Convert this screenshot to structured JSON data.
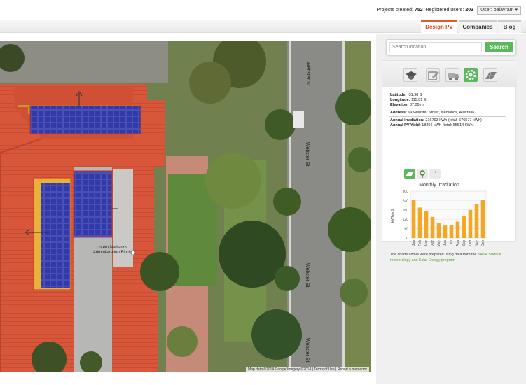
{
  "header": {
    "projects_label": "Projects created:",
    "projects_count": "752",
    "users_label": "Registered users:",
    "users_count": "203",
    "user_select": "User: balavram"
  },
  "nav": {
    "tabs": [
      {
        "label": "Design PV",
        "active": true
      },
      {
        "label": "Companies",
        "active": false
      },
      {
        "label": "Blog",
        "active": false
      }
    ]
  },
  "map": {
    "street_labels": [
      "Webster St",
      "Webster St",
      "Webster St",
      "Webster St"
    ],
    "building_label": "Loreto Nedlands Administration Block",
    "attribution": "Map data ©2014 Google Imagery ©2014 | Terms of Use | Report a map error"
  },
  "search": {
    "placeholder": "Search location...",
    "button": "Search"
  },
  "tools": [
    {
      "icon": "graduation-cap-icon"
    },
    {
      "icon": "edit-icon"
    },
    {
      "icon": "truck-icon"
    },
    {
      "icon": "gear-icon"
    },
    {
      "icon": "solar-panel-icon"
    }
  ],
  "location": {
    "latitude_label": "Latitude:",
    "latitude": "-31.98 S",
    "longitude_label": "Longitude:",
    "longitude": "115.81 E",
    "elevation_label": "Elevation:",
    "elevation": "37.06 m",
    "address_label": "Address:",
    "address": "69 Webster Street, Nedlands, Australia",
    "irradiation_label": "Annual irradiation:",
    "irradiation": "216793 kWh (total: 576577 kWh)",
    "yield_label": "Annual PV Yield:",
    "yield": "18256 kWh (total: 55514 kWh)"
  },
  "chart_tabs": [
    {
      "icon": "panel-chart-icon"
    },
    {
      "icon": "map-pin-icon"
    },
    {
      "icon": "temperature-icon",
      "label": "t°"
    }
  ],
  "chart_data": {
    "type": "bar",
    "title": "Monthly Irradiation",
    "ylabel": "kWh/m2",
    "categories": [
      "Jan",
      "Feb",
      "Mar",
      "Apr",
      "May",
      "Jun",
      "Jul",
      "Aug",
      "Sep",
      "Oct",
      "Nov",
      "Dec"
    ],
    "values": [
      245,
      195,
      170,
      135,
      95,
      80,
      85,
      105,
      140,
      180,
      215,
      245
    ],
    "yticks": [
      0,
      60,
      120,
      180,
      240,
      300
    ],
    "ylim": [
      0,
      300
    ],
    "color": "#f5a623"
  },
  "note": {
    "text": "The charts above were prepared using data from the",
    "link": "NASA Surface meteorology and Solar Energy program"
  }
}
